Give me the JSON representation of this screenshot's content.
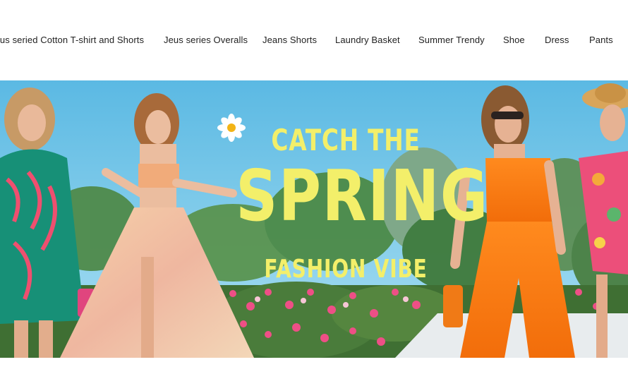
{
  "nav": {
    "items": [
      "Jeus seried Cotton T-shirt and Shorts",
      "Jeus series Overalls",
      "Jeans Shorts",
      "Laundry Basket",
      "Summer Trendy",
      "Shoe",
      "Dress",
      "Pants"
    ]
  },
  "banner": {
    "line1": "CATCH THE",
    "line2": "SPRING",
    "line3": "FASHION VIBE",
    "text_color": "#f3ef6a",
    "sky_color": "#6cc3e6"
  }
}
